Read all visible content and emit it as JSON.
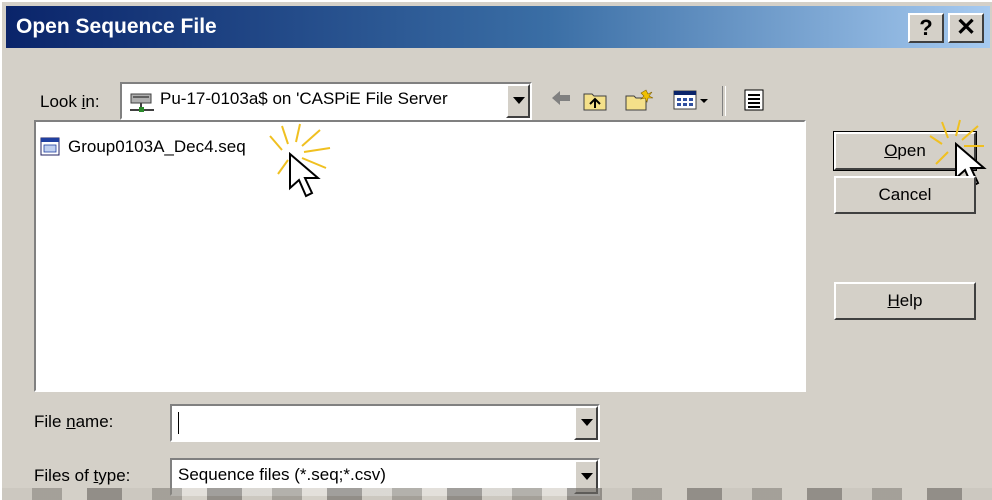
{
  "title": "Open Sequence File",
  "title_buttons": {
    "help": "?",
    "close": "✕"
  },
  "look_in": {
    "label_prefix": "Look ",
    "label_hotkey": "i",
    "label_suffix": "n:",
    "value": "Pu-17-0103a$ on 'CASPiE File Server"
  },
  "toolbar_icons": [
    "back-arrow-icon",
    "up-folder-icon",
    "new-folder-icon",
    "view-menu-icon",
    "details-view-icon"
  ],
  "files": [
    {
      "name": "Group0103A_Dec4.seq",
      "icon": "sequence-file-icon"
    }
  ],
  "file_name": {
    "label_prefix": "File ",
    "label_hotkey": "n",
    "label_suffix": "ame:",
    "value": ""
  },
  "files_of_type": {
    "label_prefix": "Files of ",
    "label_hotkey": "t",
    "label_suffix": "ype:",
    "value": "Sequence files (*.seq;*.csv)"
  },
  "buttons": {
    "open": {
      "hotkey": "O",
      "rest": "pen"
    },
    "cancel": "Cancel",
    "help": {
      "hotkey": "H",
      "rest": "elp"
    }
  },
  "colors": {
    "title_start": "#0a246a",
    "title_end": "#a6caf0",
    "face": "#d4d0c8",
    "highlight_burst": "#f0d040"
  }
}
